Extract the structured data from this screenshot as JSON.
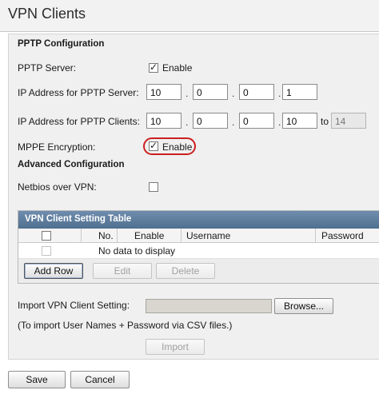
{
  "page": {
    "title": "VPN Clients"
  },
  "pptp": {
    "heading": "PPTP Configuration",
    "server_label": "PPTP Server:",
    "server_enable_label": "Enable",
    "server_enabled": true,
    "server_ip_label": "IP Address for PPTP Server:",
    "server_ip": [
      "10",
      "0",
      "0",
      "1"
    ],
    "clients_ip_label": "IP Address for PPTP Clients:",
    "clients_ip": [
      "10",
      "0",
      "0",
      "10"
    ],
    "clients_ip_to_label": "to",
    "clients_ip_end": "14",
    "mppe_label": "MPPE Encryption:",
    "mppe_enable_label": "Enable",
    "mppe_enabled": true,
    "highlight_color": "#cc1f1f"
  },
  "advanced": {
    "heading": "Advanced Configuration",
    "netbios_label": "Netbios over VPN:",
    "netbios_enabled": false
  },
  "client_table": {
    "title": "VPN Client Setting Table",
    "header_color": "#5a7898",
    "columns": [
      "No.",
      "Enable",
      "Username",
      "Password"
    ],
    "empty_text": "No data to display",
    "add_row_label": "Add Row",
    "edit_label": "Edit",
    "delete_label": "Delete"
  },
  "import": {
    "label": "Import VPN Client Setting:",
    "browse_label": "Browse...",
    "note": "(To import User Names + Password via CSV files.)",
    "import_label": "Import"
  },
  "footer": {
    "save_label": "Save",
    "cancel_label": "Cancel"
  },
  "icons": {
    "checkbox_checked": "check-mark"
  }
}
